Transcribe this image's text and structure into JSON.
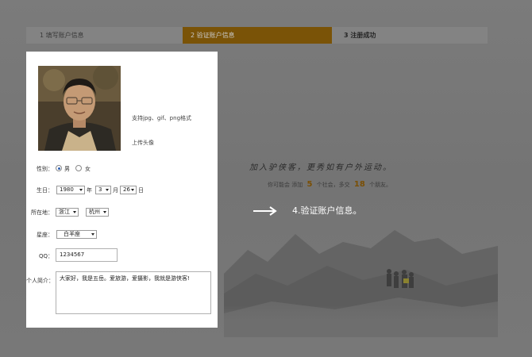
{
  "steps": [
    {
      "label": "1 填写账户信息",
      "state": "done"
    },
    {
      "label": "2 验证账户信息",
      "state": "active"
    },
    {
      "label": "3 注册成功",
      "state": "pending"
    }
  ],
  "colors": {
    "overlay": "#757575",
    "active_step": "#7a5307",
    "stat_number": "#7a4f05",
    "panel": "#ffffff"
  },
  "promo": {
    "slogan": "加入驴侠客，更秀如有户外运动。",
    "stats_prefix": "你可能会",
    "stats_mid1": "添加",
    "stats_num1": "5",
    "stats_mid2": "个社会，多交",
    "stats_num2": "18",
    "stats_suffix": "个朋友。"
  },
  "profile": {
    "format_hint": "支持jpg、gif、png格式",
    "upload_link": "上传头像",
    "gender_label": "性别：",
    "gender_male": "男",
    "gender_female": "女",
    "gender_selected": "男",
    "birthday_label": "生日：",
    "birth_year": "1980",
    "year_unit": "年",
    "birth_month": "3",
    "month_unit": "月",
    "birth_day": "26",
    "day_unit": "日",
    "location_label": "所在地：",
    "province": "浙江",
    "city": "杭州",
    "zodiac_label": "星座：",
    "zodiac": "白羊座",
    "qq_label": "QQ：",
    "qq": "1234567",
    "bio_label": "个人简介：",
    "bio": "大家好，我是五岳。爱旅游，爱摄影，我就是游侠客!"
  },
  "annotation": {
    "text": "4.验证账户信息。"
  }
}
